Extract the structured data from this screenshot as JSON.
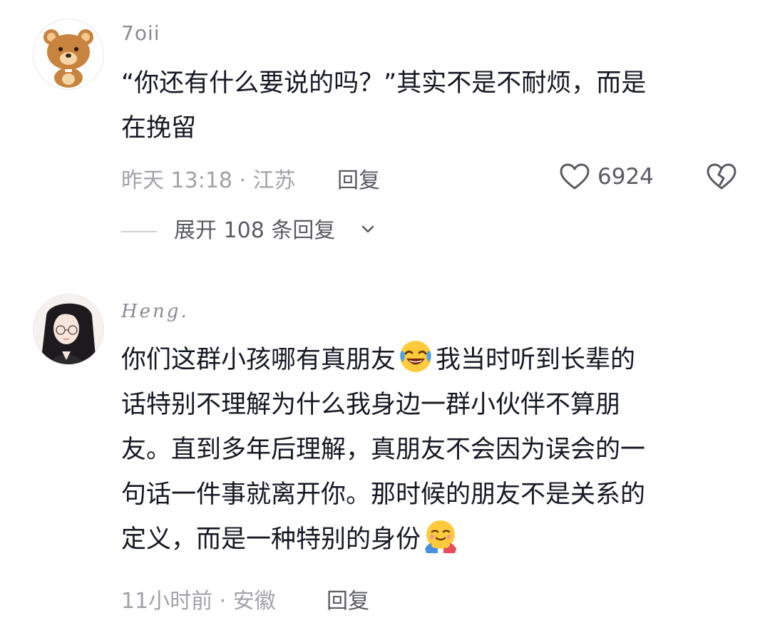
{
  "comments": [
    {
      "username": "7oii",
      "avatar_icon": "bear-avatar-icon",
      "lines": [
        "“你还有什么要说的吗？”其实不是不耐烦，而是",
        "在挽留"
      ],
      "meta": "昨天 13:18 · 江苏",
      "reply_label": "回复",
      "like_count": "6924",
      "expand_label": "展开 108 条回复"
    },
    {
      "username": "Heng.",
      "avatar_icon": "girl-avatar-icon",
      "line1_a": "你们这群小孩哪有真朋友",
      "line1_b": "我当时听到长辈的",
      "line2": "话特别不理解为什么我身边一群小伙伴不算朋",
      "line3": "友。直到多年后理解，真朋友不会因为误会的一",
      "line4": "句话一件事就离开你。那时候的朋友不是关系的",
      "line5": "定义，而是一种特别的身份",
      "emojis": [
        "laugh-cry-emoji",
        "hug-emoji"
      ],
      "meta": "11小时前 · 安徽",
      "reply_label": "回复"
    }
  ],
  "colors": {
    "text_primary": "#161823",
    "text_secondary": "#8a8b91",
    "text_meta": "#a2a3a8",
    "action": "#5a5b62",
    "background": "#ffffff"
  }
}
